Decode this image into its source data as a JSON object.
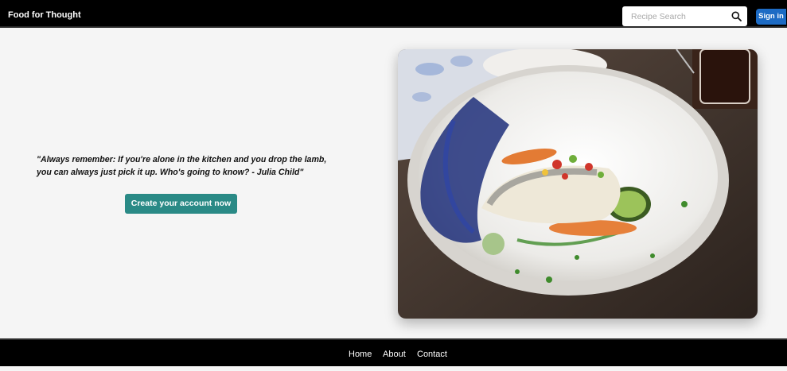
{
  "header": {
    "brand": "Food for Thought",
    "search": {
      "placeholder": "Recipe Search",
      "value": ""
    },
    "signin_label": "Sign in"
  },
  "hero": {
    "quote": "\"Always remember: If you're alone in the kitchen and you drop the lamb, you can always just pick it up. Who's going to know? - Julia Child\"",
    "cta_label": "Create your account now"
  },
  "footer": {
    "links": [
      "Home",
      "About",
      "Contact"
    ]
  },
  "colors": {
    "bar": "#000000",
    "page_background": "#f5f5f5",
    "signin": "#1d6bc4",
    "cta": "#2a8a86"
  },
  "icons": {
    "search": "search-icon"
  }
}
